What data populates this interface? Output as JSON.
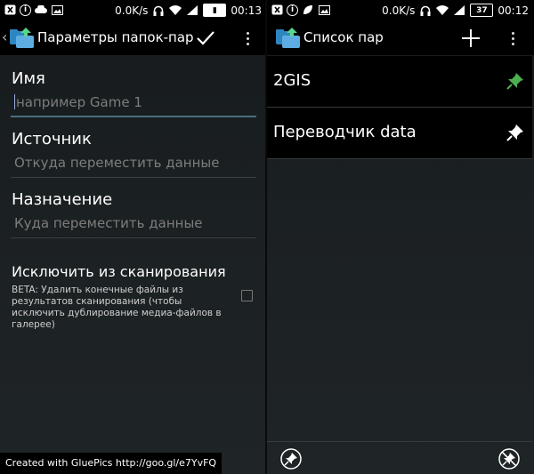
{
  "left_screen": {
    "status": {
      "speed": "0.0K/s",
      "time": "00:13"
    },
    "actionbar": {
      "title": "Параметры папок-пар"
    },
    "fields": [
      {
        "label": "Имя",
        "placeholder": "например Game 1"
      },
      {
        "label": "Источник",
        "placeholder": "Откуда переместить данные"
      },
      {
        "label": "Назначение",
        "placeholder": "Куда переместить данные"
      }
    ],
    "exclude": {
      "title": "Исключить из сканирования",
      "description": "BETA: Удалить конечные файлы из результатов сканирования (чтобы исключить дублирование медиа-файлов в галерее)",
      "checked": false
    }
  },
  "right_screen": {
    "status": {
      "speed": "0.0K/s",
      "battery": "37",
      "time": "00:12"
    },
    "actionbar": {
      "title": "Список пар"
    },
    "pairs": [
      {
        "name": "2GIS",
        "pin_color": "#4caf50"
      },
      {
        "name": "Переводчик data",
        "pin_color": "#ffffff"
      }
    ]
  },
  "watermark": "Created with GluePics http://goo.gl/e7YvFQ",
  "colors": {
    "accent_line": "#4a6f80",
    "pin_green": "#4caf50"
  }
}
